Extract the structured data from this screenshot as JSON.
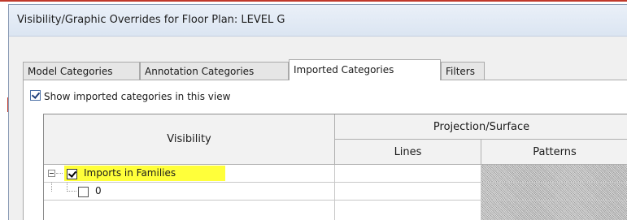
{
  "window": {
    "title": "Visibility/Graphic Overrides for Floor Plan: LEVEL G"
  },
  "tabs": [
    {
      "label": "Model Categories",
      "active": false
    },
    {
      "label": "Annotation Categories",
      "active": false
    },
    {
      "label": "Imported Categories",
      "active": true
    },
    {
      "label": "Filters",
      "active": false
    }
  ],
  "options": {
    "show_imported_label": "Show imported categories in this view",
    "show_imported_checked": true
  },
  "grid": {
    "headers": {
      "visibility": "Visibility",
      "projection_surface": "Projection/Surface",
      "lines": "Lines",
      "patterns": "Patterns"
    },
    "rows": [
      {
        "label": "Imports in Families",
        "checked": true,
        "expanded": true,
        "highlighted": true
      },
      {
        "label": "0",
        "checked": false
      }
    ]
  },
  "colors": {
    "highlight": "#ffff3a",
    "annotation_red": "#c0392b"
  },
  "icons": {
    "tree_expander": "minus-box-icon",
    "checkbox": "checkbox-icon"
  }
}
